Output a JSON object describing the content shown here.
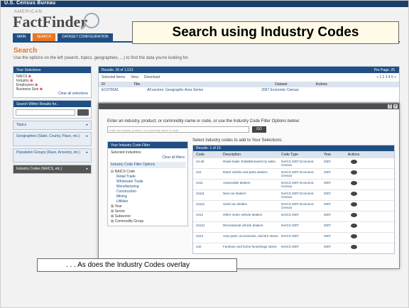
{
  "header": {
    "bureau": "U.S. Census Bureau",
    "logo_super": "AMERICAN",
    "logo": "FactFinder",
    "nav": [
      "MAIN",
      "SEARCH",
      "DATASET CONFIGURATION"
    ]
  },
  "callout": {
    "title": "Search using Industry Codes",
    "caption": ". . . As does the Industry Codes overlay"
  },
  "search": {
    "heading": "Search",
    "subtitle": "Use the options on the left (search, topics, geographies, ...) to find the data you're looking for."
  },
  "left_panel": {
    "selections_title": "Your Selections",
    "selections": [
      "NAICS",
      "Industry",
      "Employees",
      "Business Size"
    ],
    "clear_all": "Clear all selections",
    "search_within_title": "Search Within Results for...",
    "rows": [
      "Topics",
      "Geographies (State, County, Place, etc.)",
      "Population Groups (Race, Ancestry, etc.)",
      "Industry Codes (NAICS, etc.)"
    ]
  },
  "results": {
    "title": "Results: 26 of 1,513",
    "per_page": "Per Page: 25",
    "tools": [
      "Selected Items",
      "View",
      "Download"
    ],
    "pagination": "« 1 2 3 4 5 »",
    "columns": [
      "ID",
      "Title",
      "Dataset",
      "Actions"
    ],
    "first_row": [
      "EC0700A1",
      "All sectors: Geographic Area Series",
      "2007 Economic Census"
    ]
  },
  "overlay": {
    "instructions": "Enter an industry, product, or commodity name or code, or use the Industry Code Filter Options below:",
    "input_placeholder": "Enter an industry, product, or commodity name or code",
    "go": "GO",
    "filter_title": "Your Industry Code Filter",
    "filter_label": "Selected Industries",
    "filter_link": "Clear all filters",
    "options_title": "Industry Code Filter Options",
    "options": [
      "NAICS Code",
      "Retail Trade",
      "Wholesale Trade",
      "Manufacturing",
      "Construction",
      "Mining",
      "Utilities",
      "Year",
      "Sector",
      "Subsector",
      "Commodity Group"
    ],
    "select_title": "Select industry codes to add to Your Selections:",
    "table_title": "Results: 1 of 16",
    "columns": [
      "Code",
      "Description",
      "Code Type",
      "Year",
      "Actions"
    ],
    "rows": [
      [
        "44-45",
        "Retail trade: Establishments by sales",
        "NAICS 2007 Economic Census",
        "2007"
      ],
      [
        "441",
        "Motor vehicle and parts dealers",
        "NAICS 2007 Economic Census",
        "2007"
      ],
      [
        "4411",
        "Automobile dealers",
        "NAICS 2007 Economic Census",
        "2007"
      ],
      [
        "44111",
        "New car dealers",
        "NAICS 2007 Economic Census",
        "2007"
      ],
      [
        "44112",
        "Used car dealers",
        "NAICS 2007 Economic Census",
        "2007"
      ],
      [
        "4412",
        "Other motor vehicle dealers",
        "NAICS 2007",
        "2007"
      ],
      [
        "44121",
        "Recreational vehicle dealers",
        "NAICS 2007",
        "2007"
      ],
      [
        "4413",
        "Auto parts, accessories, and tire stores",
        "NAICS 2007",
        "2007"
      ],
      [
        "442",
        "Furniture and home furnishings stores",
        "NAICS 2007",
        "2007"
      ]
    ]
  }
}
